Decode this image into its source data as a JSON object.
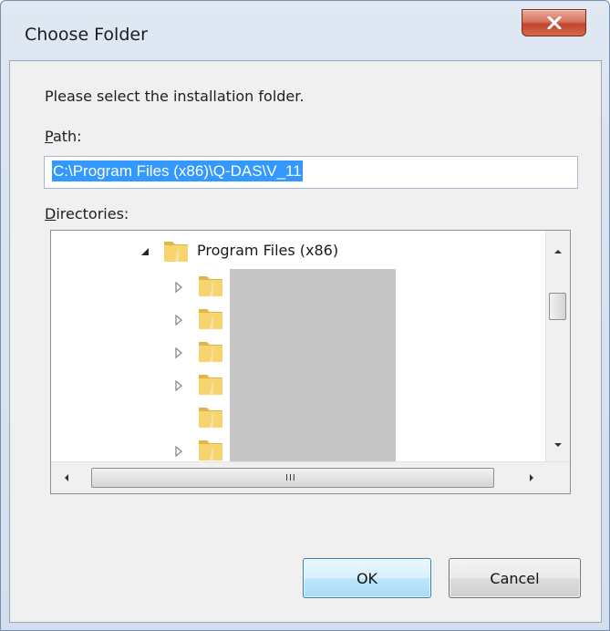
{
  "window": {
    "title": "Choose Folder"
  },
  "dialog": {
    "prompt": "Please select the installation folder.",
    "path_label_access_key": "P",
    "path_label_rest": "ath:",
    "path_value": "C:\\Program Files (x86)\\Q-DAS\\V_11",
    "directories_label_access_key": "D",
    "directories_label_rest": "irectories:"
  },
  "tree": {
    "expanded_folder": "Program Files (x86)",
    "child_folders_visible": 6
  },
  "buttons": {
    "ok_label": "OK",
    "cancel_label": "Cancel"
  },
  "colors": {
    "selection": "#3399ff",
    "close_button": "#c4452c",
    "ok_button_border": "#3c7fb1"
  }
}
